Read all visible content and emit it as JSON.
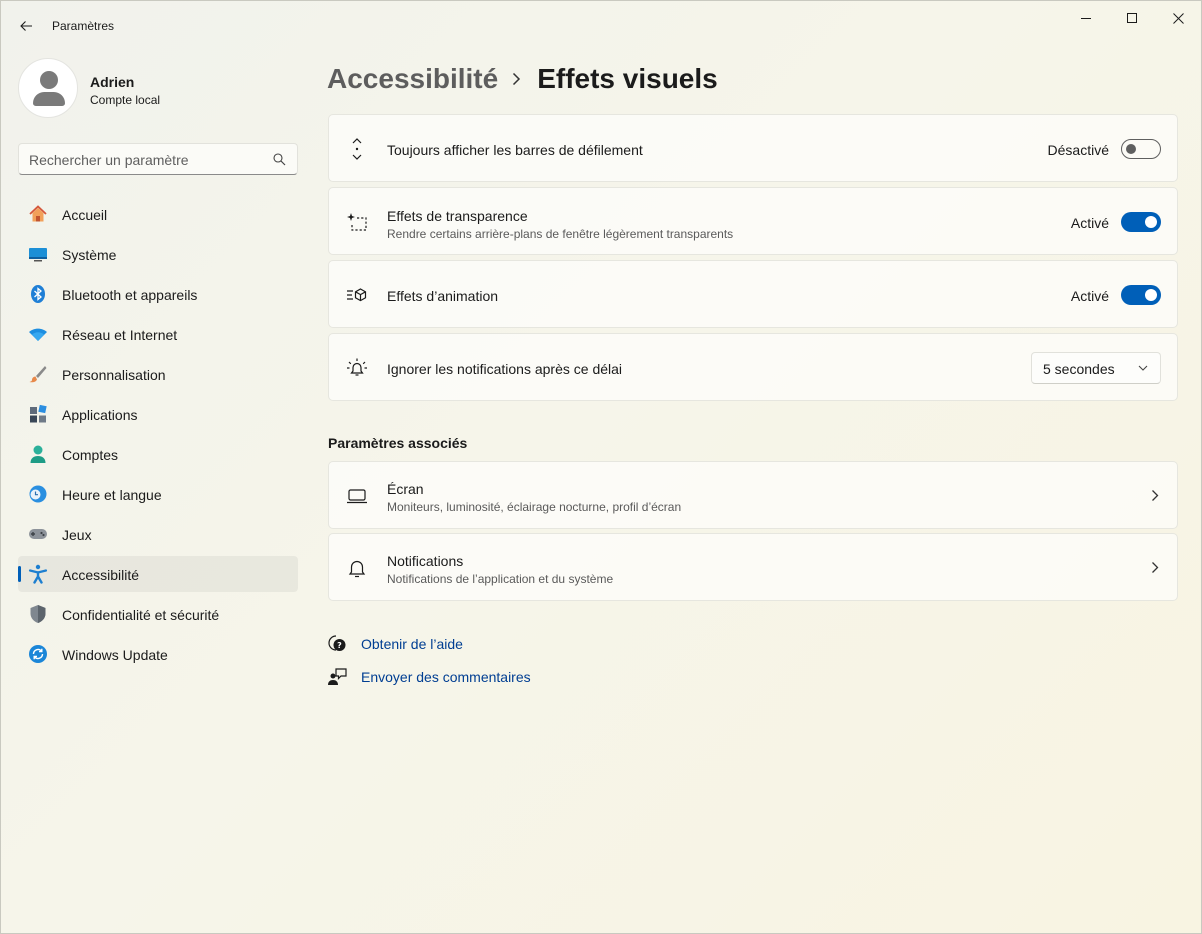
{
  "window": {
    "title": "Paramètres"
  },
  "profile": {
    "name": "Adrien",
    "account_type": "Compte local"
  },
  "search": {
    "placeholder": "Rechercher un paramètre"
  },
  "sidebar": {
    "items": [
      {
        "label": "Accueil",
        "icon": "home-icon"
      },
      {
        "label": "Système",
        "icon": "system-icon"
      },
      {
        "label": "Bluetooth et appareils",
        "icon": "bluetooth-icon"
      },
      {
        "label": "Réseau et Internet",
        "icon": "wifi-icon"
      },
      {
        "label": "Personnalisation",
        "icon": "brush-icon"
      },
      {
        "label": "Applications",
        "icon": "apps-icon"
      },
      {
        "label": "Comptes",
        "icon": "accounts-icon"
      },
      {
        "label": "Heure et langue",
        "icon": "time-language-icon"
      },
      {
        "label": "Jeux",
        "icon": "gamepad-icon"
      },
      {
        "label": "Accessibilité",
        "icon": "accessibility-icon",
        "selected": true
      },
      {
        "label": "Confidentialité et sécurité",
        "icon": "shield-icon"
      },
      {
        "label": "Windows Update",
        "icon": "update-icon"
      }
    ]
  },
  "breadcrumb": {
    "parent": "Accessibilité",
    "current": "Effets visuels"
  },
  "settings": {
    "scrollbars": {
      "title": "Toujours afficher les barres de défilement",
      "state": "Désactivé",
      "on": false,
      "icon": "scrollbar-icon"
    },
    "transparency": {
      "title": "Effets de transparence",
      "subtitle": "Rendre certains arrière-plans de fenêtre légèrement transparents",
      "state": "Activé",
      "on": true,
      "icon": "transparency-icon"
    },
    "animation": {
      "title": "Effets d’animation",
      "state": "Activé",
      "on": true,
      "icon": "animation-icon"
    },
    "notifications_timeout": {
      "title": "Ignorer les notifications après ce délai",
      "value": "5 secondes",
      "icon": "notification-timer-icon"
    }
  },
  "related": {
    "title": "Paramètres associés",
    "items": [
      {
        "title": "Écran",
        "subtitle": "Moniteurs, luminosité, éclairage nocturne, profil d’écran",
        "icon": "display-icon"
      },
      {
        "title": "Notifications",
        "subtitle": "Notifications de l’application et du système",
        "icon": "bell-icon"
      }
    ]
  },
  "help": {
    "get_help": "Obtenir de l’aide",
    "feedback": "Envoyer des commentaires"
  },
  "colors": {
    "accent": "#005fb8",
    "link": "#003e92"
  }
}
